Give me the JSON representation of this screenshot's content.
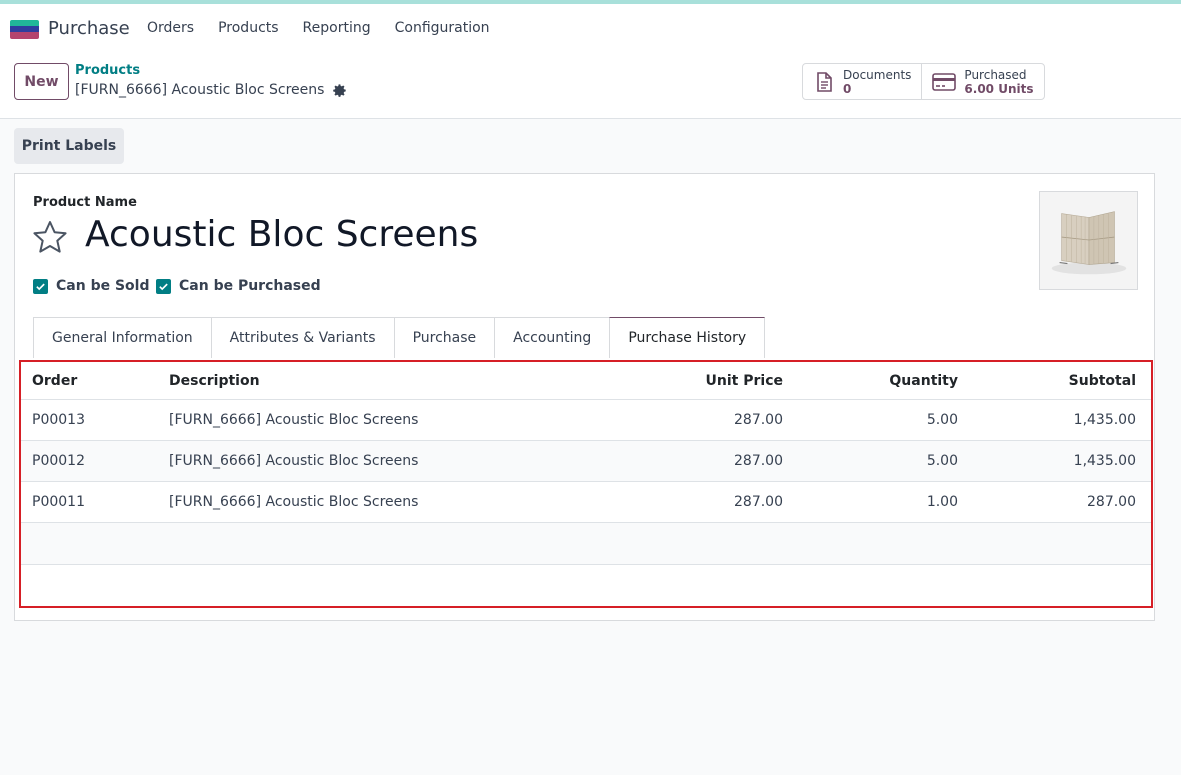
{
  "app": {
    "name": "Purchase"
  },
  "menu": [
    "Orders",
    "Products",
    "Reporting",
    "Configuration"
  ],
  "control": {
    "new_label": "New",
    "breadcrumb_parent": "Products",
    "breadcrumb_current": "[FURN_6666] Acoustic Bloc Screens"
  },
  "stats": {
    "documents": {
      "label": "Documents",
      "value": "0",
      "icon": "document-icon"
    },
    "purchased": {
      "label": "Purchased",
      "value": "6.00 Units",
      "icon": "credit-card-icon"
    }
  },
  "actions": {
    "print_labels": "Print Labels"
  },
  "form": {
    "product_name_label": "Product Name",
    "product_name": "Acoustic Bloc Screens",
    "can_be_sold": "Can be Sold",
    "can_be_purchased": "Can be Purchased"
  },
  "tabs": [
    "General Information",
    "Attributes & Variants",
    "Purchase",
    "Accounting",
    "Purchase History"
  ],
  "table": {
    "headers": {
      "order": "Order",
      "description": "Description",
      "unit_price": "Unit Price",
      "quantity": "Quantity",
      "subtotal": "Subtotal"
    },
    "rows": [
      {
        "order": "P00013",
        "description": "[FURN_6666] Acoustic Bloc Screens",
        "unit_price": "287.00",
        "quantity": "5.00",
        "subtotal": "1,435.00"
      },
      {
        "order": "P00012",
        "description": "[FURN_6666] Acoustic Bloc Screens",
        "unit_price": "287.00",
        "quantity": "5.00",
        "subtotal": "1,435.00"
      },
      {
        "order": "P00011",
        "description": "[FURN_6666] Acoustic Bloc Screens",
        "unit_price": "287.00",
        "quantity": "1.00",
        "subtotal": "287.00"
      }
    ]
  },
  "colors": {
    "brand": "#714b67",
    "teal": "#017e84",
    "highlight": "#d61f26"
  }
}
